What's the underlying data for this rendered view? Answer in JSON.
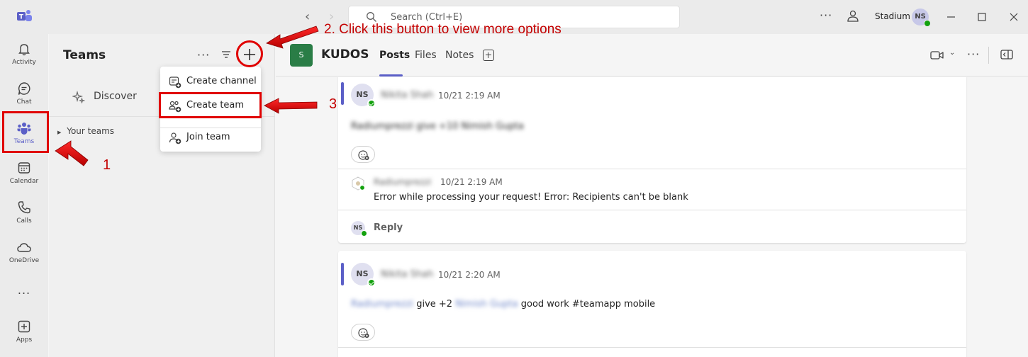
{
  "titlebar": {
    "search_placeholder": "Search (Ctrl+E)",
    "org_name": "Stadium",
    "user_initials": "NS"
  },
  "rail": {
    "items": [
      {
        "label": "Activity",
        "icon": "bell-icon"
      },
      {
        "label": "Chat",
        "icon": "chat-icon"
      },
      {
        "label": "Teams",
        "icon": "teams-icon",
        "active": true
      },
      {
        "label": "Calendar",
        "icon": "calendar-icon"
      },
      {
        "label": "Calls",
        "icon": "phone-icon"
      },
      {
        "label": "OneDrive",
        "icon": "cloud-icon"
      },
      {
        "label": "Apps",
        "icon": "apps-add-icon"
      }
    ],
    "more_label": "..."
  },
  "panel": {
    "title": "Teams",
    "discover_label": "Discover",
    "your_teams_label": "Your teams"
  },
  "menu": {
    "items": [
      {
        "label": "Create channel",
        "icon": "create-channel-icon"
      },
      {
        "label": "Create team",
        "icon": "create-team-icon"
      },
      {
        "label": "Join team",
        "icon": "join-team-icon"
      }
    ]
  },
  "header": {
    "team_tile_letter": "S",
    "team_name": "KUDOS",
    "tabs": [
      "Posts",
      "Files",
      "Notes"
    ],
    "active_tab": "Posts"
  },
  "posts": [
    {
      "initials": "NS",
      "author": "Nikita Shah",
      "time": "10/21 2:19 AM",
      "body_blurred": "Radiumprezzi give +10 Nimish Gupta",
      "reply": {
        "author": "Radiumprezzi",
        "time": "10/21 2:19 AM",
        "text": "Error while processing your request! Error: Recipients can't be blank"
      },
      "reply_label": "Reply",
      "reply_initials": "NS"
    },
    {
      "initials": "NS",
      "author": "Nikita Shah",
      "time": "10/21 2:20 AM",
      "mention_1": "Radiumprezzi",
      "text_mid": "give +2",
      "mention_2": "Nimish Gupta",
      "text_end": "good work #teamapp mobile"
    }
  ],
  "annotations": {
    "step1": "1",
    "step2": "2. Click this button to view more options",
    "step3": "3",
    "color": "#e00000"
  }
}
